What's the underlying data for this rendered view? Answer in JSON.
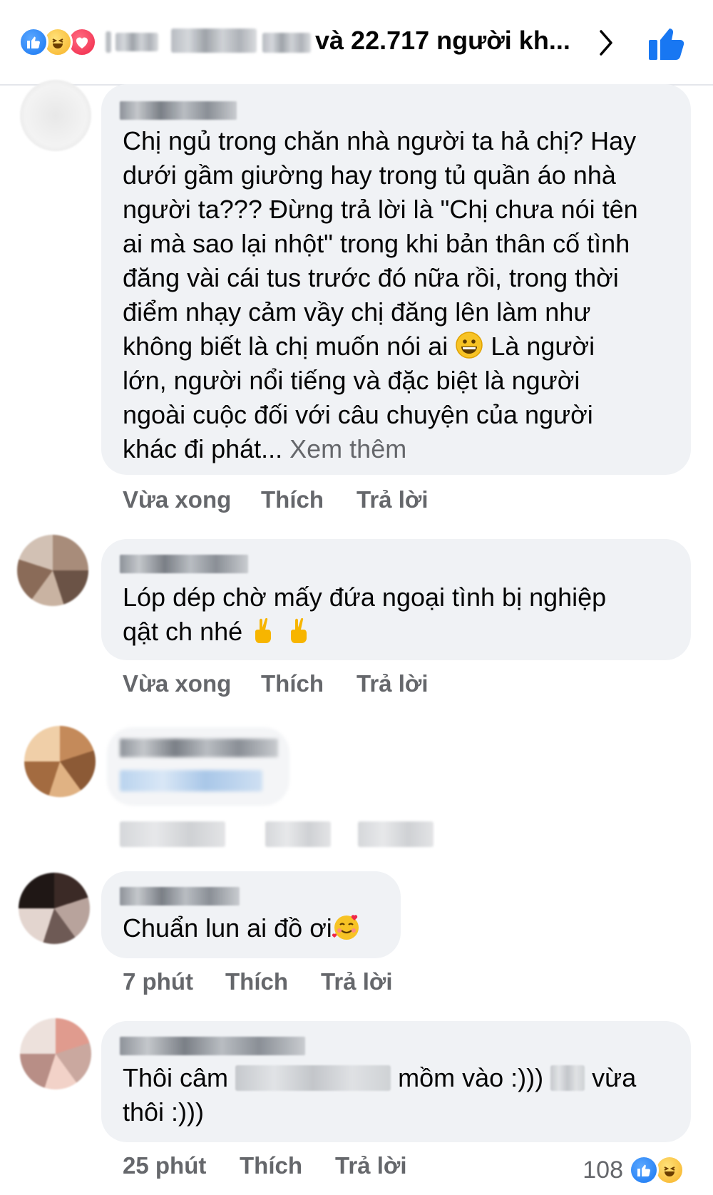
{
  "header": {
    "reaction_icons": [
      "like-icon",
      "haha-icon",
      "love-icon"
    ],
    "reactors_text": "và 22.717 người kh...",
    "chevron": "chevron-right-icon",
    "like_button_icon": "thumbs-up-icon",
    "accent": "#1877f2"
  },
  "comments": [
    {
      "text": "Chị ngủ trong chăn nhà người ta hả chị? Hay\ndưới gầm giường hay trong tủ quần áo nhà\nngười ta??? Đừng trả lời là \"Chị chưa nói tên\nai mà sao lại nhột\" trong khi bản thân cố tình\nđăng vài cái tus trước đó nữa rồi, trong thời\nđiểm nhạy cảm vầy chị đăng lên làm như\nkhông biết là chị muốn nói ai",
      "text_after_emoji": " Là người\nlớn, người nổi tiếng và đặc biệt là người\nngoài cuộc đối với câu chuyện của người\nkhác đi phát...",
      "see_more": " Xem thêm",
      "time": "Vừa xong",
      "like": "Thích",
      "reply": "Trả lời"
    },
    {
      "text": "Lóp dép chờ mấy đứa ngoại tình bị nghiệp\nqật ch nhé",
      "time": "Vừa xong",
      "like": "Thích",
      "reply": "Trả lời"
    },
    {
      "text": "",
      "time": "",
      "like": "",
      "reply": ""
    },
    {
      "text": "Chuẩn lun ai đồ ơi",
      "time": "7 phút",
      "like": "Thích",
      "reply": "Trả lời"
    },
    {
      "text_part1": "Thôi câm",
      "text_part2": "mồm vào :)))",
      "text_part3": "vừa",
      "text_line2": "thôi :)))",
      "time": "25 phút",
      "like": "Thích",
      "reply": "Trả lời",
      "reaction_count": "108"
    }
  ],
  "colors": {
    "bubble": "#f0f2f5",
    "meta": "#65676b",
    "text": "#050505"
  }
}
